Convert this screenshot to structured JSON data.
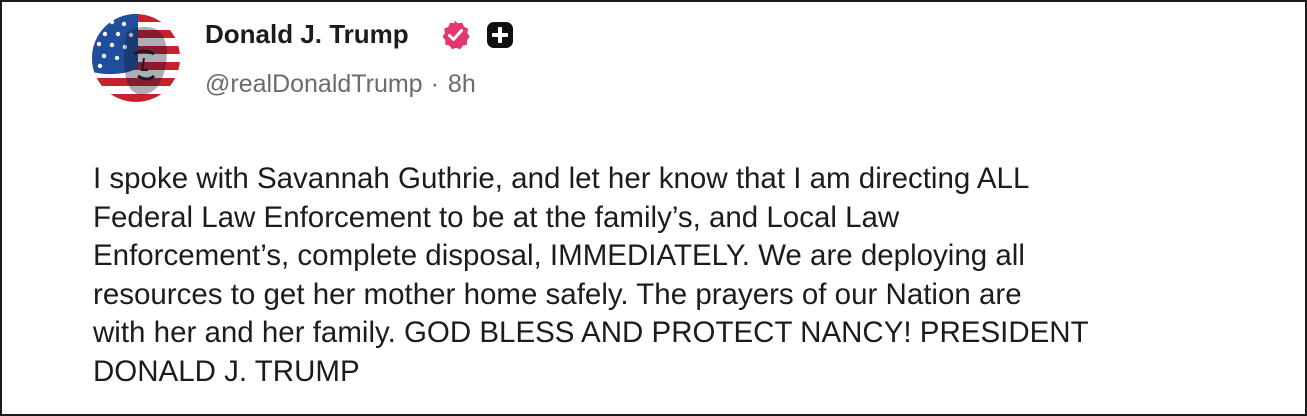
{
  "post": {
    "author": {
      "display_name": "Donald J. Trump",
      "handle": "@realDonaldTrump",
      "verified_icon": "verified-badge-icon",
      "extra_icon": "plus-badge-icon",
      "avatar": "flag-painted-face-avatar"
    },
    "separator": "·",
    "timestamp": "8h",
    "body_lines": [
      "I spoke with Savannah Guthrie, and let her know that I am directing ALL",
      "Federal Law Enforcement to be at the family’s, and Local Law",
      "Enforcement’s, complete disposal, IMMEDIATELY. We are deploying all",
      "resources to get her mother home safely. The prayers of our Nation are",
      "with her and her family. GOD BLESS AND PROTECT NANCY! PRESIDENT",
      "DONALD J. TRUMP"
    ]
  },
  "colors": {
    "verified_badge": "#e4366f",
    "text_primary": "#1c1c1c",
    "text_secondary": "#6b6b6b",
    "border": "#1a1a1a"
  }
}
